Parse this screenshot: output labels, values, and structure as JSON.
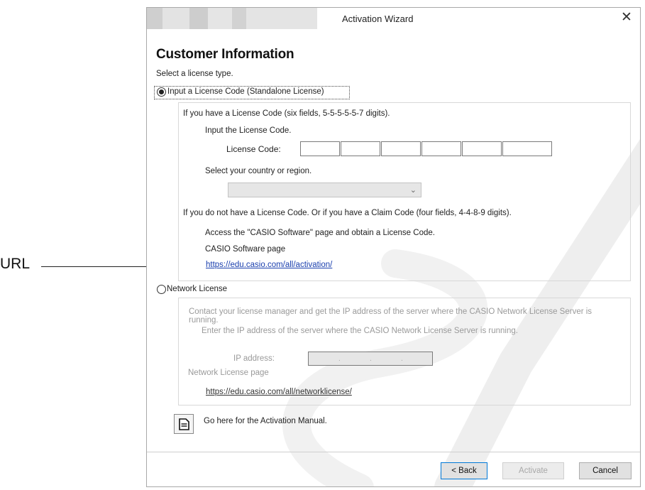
{
  "annotation": {
    "label": "URL"
  },
  "window": {
    "title": "Activation Wizard",
    "close_glyph": "✕"
  },
  "page": {
    "heading": "Customer Information",
    "select_prompt": "Select a license type."
  },
  "standalone": {
    "radio_label": "Input a License Code (Standalone License)",
    "selected": true,
    "have_code_text": "If you have a License Code (six fields, 5-5-5-5-5-7 digits).",
    "input_prompt": "Input the License Code.",
    "code_label": "License Code:",
    "code_fields": [
      "",
      "",
      "",
      "",
      "",
      ""
    ],
    "country_prompt": "Select your country or region.",
    "country_value": "",
    "no_code_text": "If you do not have a License Code. Or if you have a Claim Code (four fields, 4-4-8-9 digits).",
    "access_text": "Access the \"CASIO Software\" page and obtain a License Code.",
    "software_page_label": "CASIO Software page",
    "software_page_url": "https://edu.casio.com/all/activation/"
  },
  "network": {
    "radio_label": "Network License",
    "selected": false,
    "contact_text": "Contact your license manager and get the IP address of the server where the CASIO Network License Server is running.",
    "enter_ip_text": "Enter the IP address of the server where the CASIO Network License Server is running.",
    "ip_label": "IP address:",
    "ip_value": "",
    "page_label": "Network License page",
    "page_url": "https://edu.casio.com/all/networklicense/"
  },
  "manual": {
    "icon": "document-icon",
    "label": "Go here for the Activation Manual."
  },
  "buttons": {
    "back": "< Back",
    "activate": "Activate",
    "cancel": "Cancel"
  }
}
